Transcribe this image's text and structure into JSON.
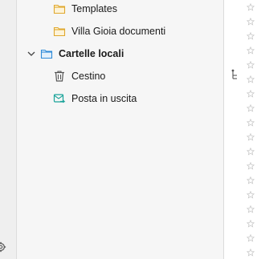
{
  "folders": [
    {
      "label": "Templates",
      "icon": "folder-icon"
    },
    {
      "label": "Villa Gioia documenti",
      "icon": "folder-icon"
    }
  ],
  "local_account": {
    "label": "Cartelle locali",
    "expanded": true,
    "icon": "local-folders-icon"
  },
  "local_folders": [
    {
      "label": "Cestino",
      "icon": "trash-icon"
    },
    {
      "label": "Posta in uscita",
      "icon": "outbox-icon"
    }
  ],
  "colors": {
    "folder_icon": "#e8b33c",
    "local_folder_icon": "#2f8bd8",
    "outbox_icon": "#1aa39a",
    "pane_bg": "#f6f6f6"
  }
}
